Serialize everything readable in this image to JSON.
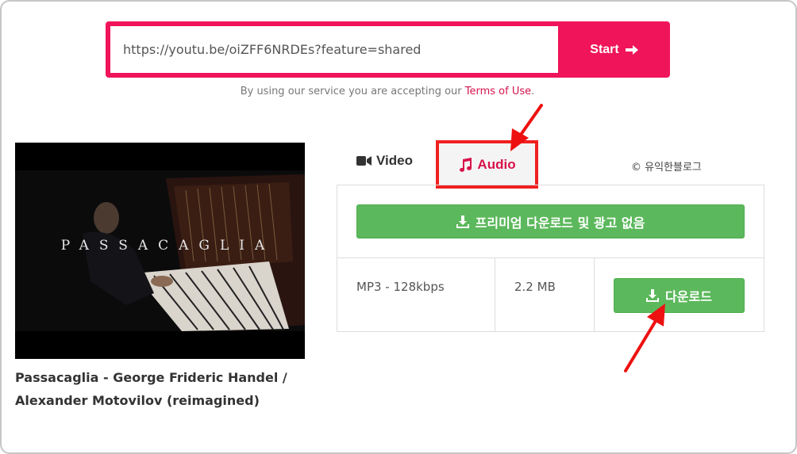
{
  "url_input": {
    "value": "https://youtu.be/oiZFF6NRDEs?feature=shared"
  },
  "start_button": {
    "label": "Start",
    "icon": "arrow-right-icon"
  },
  "terms": {
    "prefix": "By using our service you are accepting our ",
    "link": "Terms of Use",
    "suffix": "."
  },
  "video": {
    "thumbnail_caption": "PASSACAGLIA",
    "title": "Passacaglia - George Frideric Handel / Alexander Motovilov (reimagined)"
  },
  "tabs": {
    "video_label": "Video",
    "audio_label": "Audio",
    "video_icon": "video-camera-icon",
    "audio_icon": "music-note-icon"
  },
  "watermark": "© 유익한블로그",
  "premium_button": {
    "label": "프리미엄 다운로드 및 광고 없음",
    "icon": "download-icon"
  },
  "audio_row": {
    "format": "MP3 - 128kbps",
    "size": "2.2 MB",
    "download_label": "다운로드",
    "download_icon": "download-icon"
  },
  "colors": {
    "accent": "#f0145a",
    "highlight_box": "#f02020",
    "button_green": "#5cb85c",
    "audio_tab_text": "#d8124a"
  }
}
